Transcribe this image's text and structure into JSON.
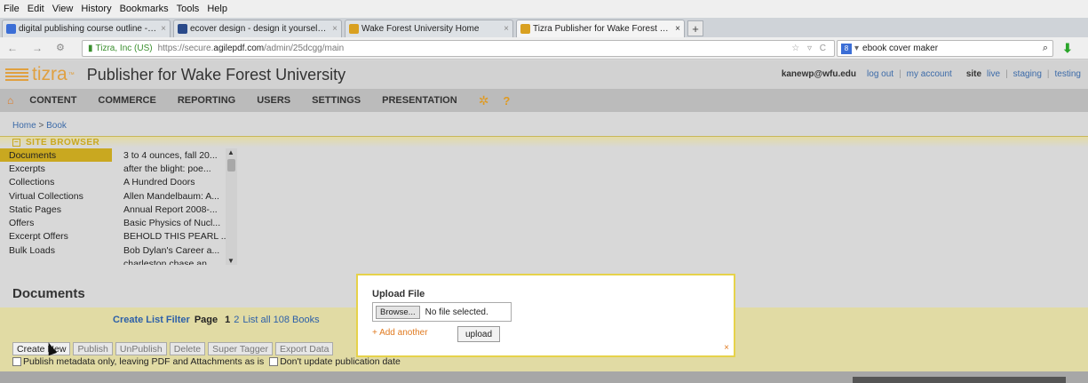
{
  "menubar": [
    "File",
    "Edit",
    "View",
    "History",
    "Bookmarks",
    "Tools",
    "Help"
  ],
  "tabs": [
    {
      "title": "digital publishing course outline - Go...",
      "close": "×",
      "color": "#3b6ed6",
      "active": false
    },
    {
      "title": "ecover design - design it yourself onli...",
      "close": "×",
      "color": "#2a4a8a",
      "active": false
    },
    {
      "title": "Wake Forest University Home",
      "close": "×",
      "color": "#d9a020",
      "active": false
    },
    {
      "title": "Tizra Publisher for Wake Forest Unive...",
      "close": "×",
      "color": "#d9a020",
      "active": true
    }
  ],
  "newtab_label": "+",
  "nav": {
    "back": "←",
    "forward": "→",
    "identity": "⚙",
    "site": "Tizra, Inc (US)",
    "url_prefix": "https://secure.",
    "url_host": "agilepdf.com",
    "url_path": "/admin/25dcgg/main",
    "url_right": "☆ ▿ C",
    "search_engine": "8",
    "search_value": "ebook cover maker",
    "search_icon": "⌕",
    "download_icon": "⬇"
  },
  "header": {
    "logo_text": "tizra",
    "logo_tm": "™",
    "title": "Publisher for Wake Forest University",
    "user_email": "kanewp@wfu.edu",
    "logout": "log out",
    "sep": "|",
    "my_account": "my account",
    "site_label": "site",
    "live": "live",
    "staging": "staging",
    "testing": "testing"
  },
  "mainnav": {
    "home_icon": "⌂",
    "items": [
      "CONTENT",
      "COMMERCE",
      "REPORTING",
      "USERS",
      "SETTINGS",
      "PRESENTATION"
    ],
    "gear_icon": "✲",
    "help_icon": "?"
  },
  "breadcrumb": {
    "home": "Home",
    "sep": " > ",
    "current": "Book"
  },
  "site_browser": {
    "title": "SITE BROWSER",
    "toggle": "−",
    "sections": [
      "Documents",
      "Excerpts",
      "Collections",
      "Virtual Collections",
      "Static Pages",
      "Offers",
      "Excerpt Offers",
      "Bulk Loads"
    ],
    "documents": [
      "3 to 4 ounces, fall 20...",
      "after the blight: poe...",
      "A Hundred Doors",
      "Allen Mandelbaum: A...",
      "Annual Report 2008-...",
      "Basic Physics of Nucl...",
      "BEHOLD THIS PEARL ...",
      "Bob Dylan's Career a...",
      "charleston chase an..."
    ],
    "scroll_up": "▲",
    "scroll_down": "▼"
  },
  "documents_section": {
    "title": "Documents",
    "create_filter": "Create List Filter",
    "page_label": "Page",
    "page_current": "1",
    "page_2": "2",
    "list_all": "List all 108 Books",
    "buttons": [
      "Create New",
      "Publish",
      "UnPublish",
      "Delete",
      "Super Tagger",
      "Export Data"
    ],
    "check_publish_meta": "Publish metadata only, leaving PDF and Attachments as is",
    "check_no_update": "Don't update publication date"
  },
  "upload_modal": {
    "title": "Upload File",
    "browse": "Browse...",
    "no_file": "No file selected.",
    "add_another": "+ Add another",
    "upload": "upload",
    "close": "×"
  }
}
